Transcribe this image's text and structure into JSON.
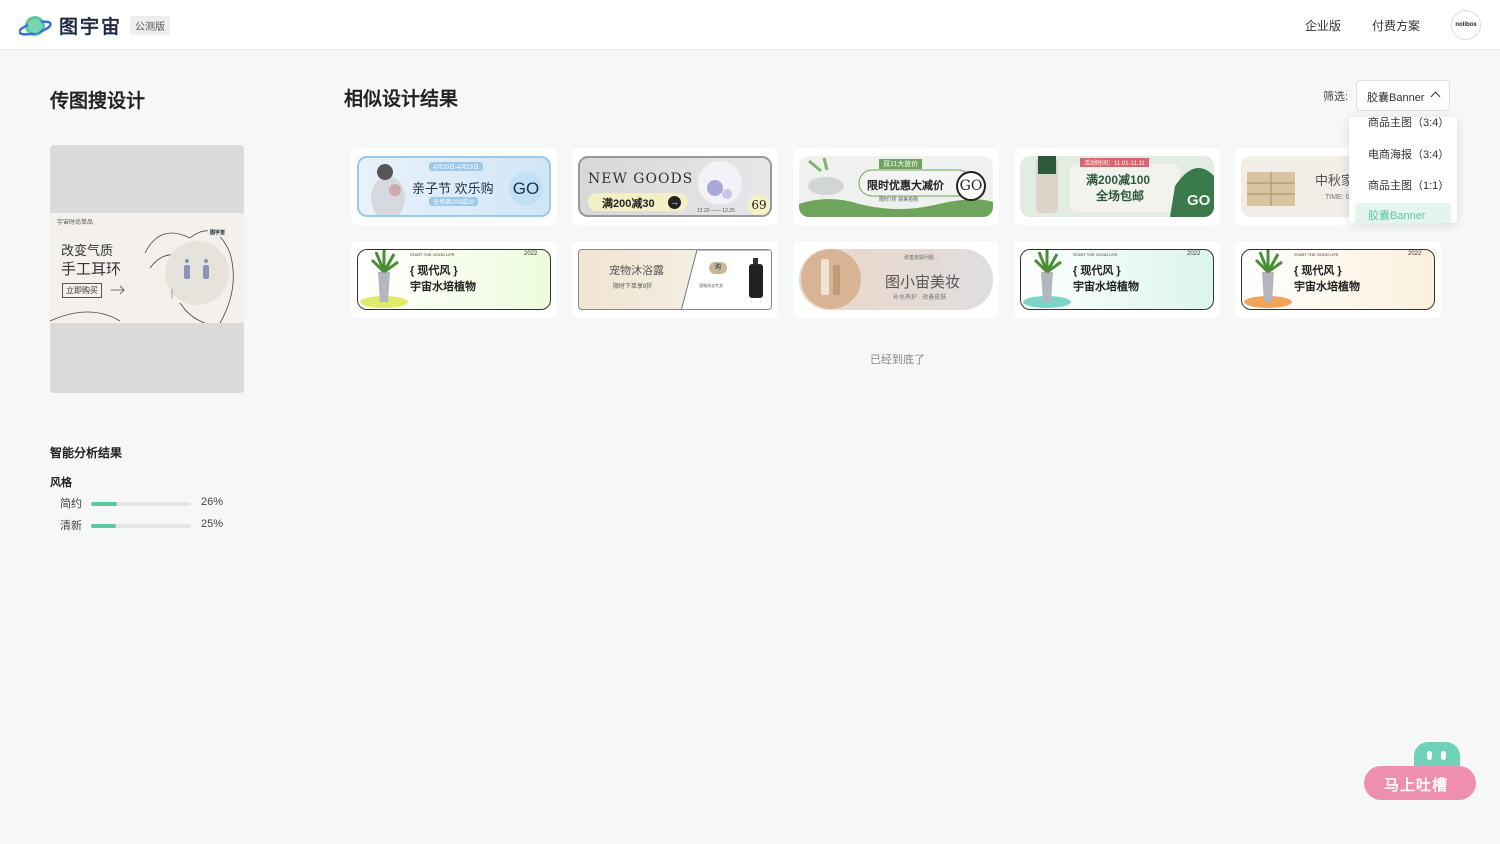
{
  "header": {
    "logo_text": "图宇宙",
    "badge": "公测版",
    "nav_enterprise": "企业版",
    "nav_pricing": "付费方案",
    "avatar_text": "nolibox"
  },
  "left_panel": {
    "title": "传图搜设计",
    "upload_preview": {
      "tag": "宇宙时尚单品",
      "line1": "改变气质",
      "line2": "手工耳环",
      "button": "立即购买",
      "brand": "图宇宙"
    },
    "analysis": {
      "title": "智能分析结果",
      "style_label": "风格",
      "styles": [
        {
          "name": "简约",
          "percent": "26%",
          "value": 0.26
        },
        {
          "name": "清新",
          "percent": "25%",
          "value": 0.25
        }
      ]
    }
  },
  "main": {
    "title": "相似设计结果",
    "filter_label": "筛选:",
    "filter_value": "胶囊Banner",
    "dropdown_options": [
      "商品主图（3:4）",
      "电商海报（3:4）",
      "商品主图（1:1）",
      "胶囊Banner"
    ],
    "end_text": "已经到底了",
    "results": [
      {
        "main": "亲子节 欢乐购",
        "sub": "4月20日-4月23日",
        "small": "全场满200减20",
        "cta": "GO"
      },
      {
        "main": "NEW GOODS",
        "sub": "满200减30",
        "small": "12.20 —— 12.25",
        "cta": "69"
      },
      {
        "main": "限时优惠大减价",
        "sub": "双11大放价",
        "small": "限时7折 快来抢购",
        "cta": "GO"
      },
      {
        "main": "满200减100",
        "sub": "全场包邮",
        "small": "活动时间：11.01-11.11",
        "cta": "GO"
      },
      {
        "main": "中秋家",
        "sub": "TIME: 0",
        "small": "",
        "cta": ""
      },
      {
        "main": "{ 现代风 }",
        "sub": "宇宙水培植物",
        "small": "START THE GOOD LIFE",
        "cta": "2022"
      },
      {
        "main": "宠物沐浴露",
        "sub": "限时下单享8折",
        "small": "宠物沐浴专卖",
        "cta": "购"
      },
      {
        "main": "图小宙美妆",
        "sub": "补水养护 · 改善皮肤",
        "small": "· 改善皮肤问题 ·",
        "cta": ""
      },
      {
        "main": "{ 现代风 }",
        "sub": "宇宙水培植物",
        "small": "START THE GOOD LIFE",
        "cta": "2022"
      },
      {
        "main": "{ 现代风 }",
        "sub": "宇宙水培植物",
        "small": "START THE GOOD LIFE",
        "cta": "2022"
      }
    ]
  },
  "feedback": {
    "label": "马上吐槽"
  },
  "colors": {
    "accent": "#5fc79f",
    "feedback": "#ef8fb0",
    "background": "#f6f7f7"
  }
}
